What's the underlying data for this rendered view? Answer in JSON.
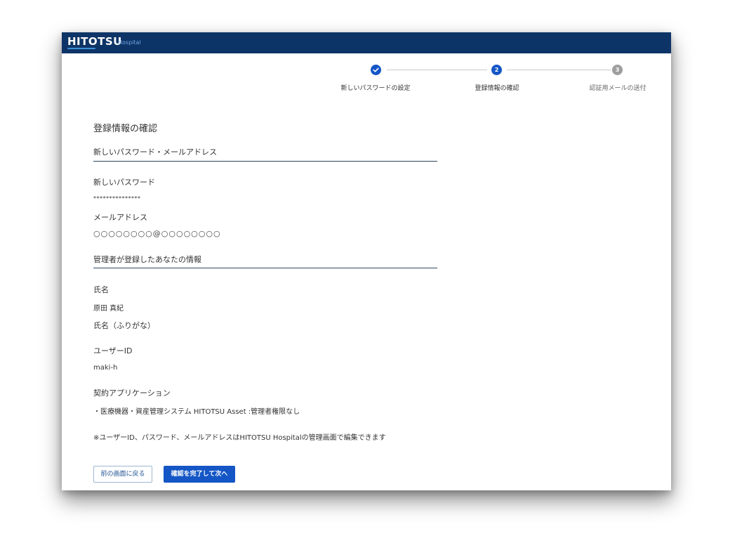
{
  "app": {
    "logo": "HITOTSU",
    "logo_sub": "Hospital"
  },
  "stepper": {
    "steps": [
      {
        "number": "",
        "label": "新しいパスワードの設定",
        "state": "done"
      },
      {
        "number": "2",
        "label": "登録情報の確認",
        "state": "active"
      },
      {
        "number": "3",
        "label": "認証用メールの送付",
        "state": "pending"
      }
    ],
    "colors": {
      "active": "#1456c6",
      "pending": "#9e9e9e"
    }
  },
  "page": {
    "title": "登録情報の確認"
  },
  "section1": {
    "heading": "新しいパスワード・メールアドレス",
    "password_label": "新しいパスワード",
    "password_value": "***************",
    "email_label": "メールアドレス",
    "email_value": "○○○○○○○○@○○○○○○○○"
  },
  "section2": {
    "heading": "管理者が登録したあなたの情報",
    "name_label": "氏名",
    "name_value": "原田 真紀",
    "furigana_label": "氏名（ふりがな）",
    "userid_label": "ユーザーID",
    "userid_value": "maki-h",
    "apps_label": "契約アプリケーション",
    "apps_value": "・医療機器・資産管理システム HITOTSU Asset :管理者権限なし"
  },
  "note": "※ユーザーID、パスワード、メールアドレスはHITOTSU Hospitalの管理画面で編集できます",
  "buttons": {
    "back": "前の画面に戻る",
    "next": "確認を完了して次へ"
  },
  "theme": {
    "header_bg": "#0d3466",
    "primary": "#1456c6"
  }
}
